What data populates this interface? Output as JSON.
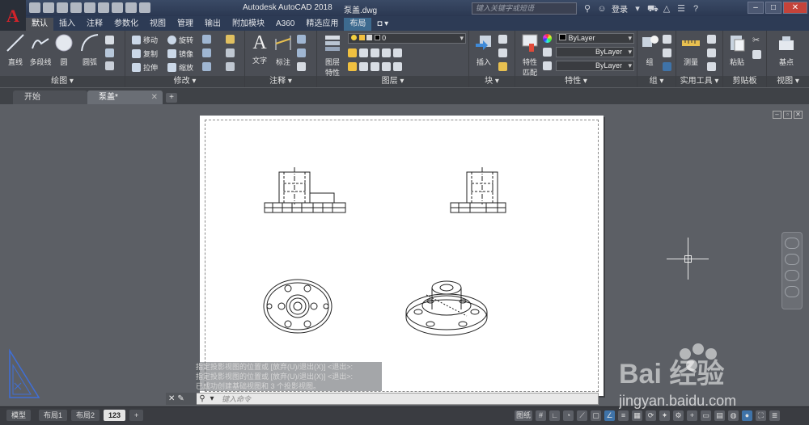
{
  "window": {
    "app_title": "Autodesk AutoCAD 2018",
    "file_title": "泵盖.dwg",
    "search_placeholder": "键入关键字或短语",
    "login_label": "登录",
    "app_letter": "A"
  },
  "ribbon_tabs": [
    "默认",
    "插入",
    "注释",
    "参数化",
    "视图",
    "管理",
    "输出",
    "附加模块",
    "A360",
    "精选应用",
    "布局",
    "◘ ▾"
  ],
  "ribbon": {
    "draw": {
      "title": "绘图 ▾",
      "line": "直线",
      "polyline": "多段线",
      "circle": "圆",
      "arc": "圆弧"
    },
    "modify": {
      "title": "修改 ▾",
      "move": "移动",
      "rotate": "旋转",
      "copy": "复制",
      "mirror": "镜像",
      "stretch": "拉伸",
      "scale": "缩放"
    },
    "annotation": {
      "title": "注释 ▾",
      "text": "文字",
      "dimension": "标注"
    },
    "layers": {
      "title": "图层 ▾",
      "properties_line1": "图层",
      "properties_line2": "特性",
      "current_layer": "0"
    },
    "block": {
      "title": "块 ▾",
      "insert": "插入"
    },
    "properties": {
      "title": "特性 ▾",
      "match_line1": "特性",
      "match_line2": "匹配",
      "color": "ByLayer",
      "linetype": "ByLayer",
      "lineweight": "ByLayer"
    },
    "groups": {
      "title": "组 ▾",
      "group": "组"
    },
    "utilities": {
      "title": "实用工具 ▾",
      "measure": "测量"
    },
    "clipboard": {
      "title": "剪贴板",
      "paste": "粘贴"
    },
    "view": {
      "title": "视图 ▾",
      "base": "基点"
    }
  },
  "doc_tabs": [
    {
      "label": "开始"
    },
    {
      "label": "泵盖*"
    }
  ],
  "command": {
    "history": [
      "指定投影视图的位置或 [放弃(U)/退出(X)] <退出>:",
      "指定投影视图的位置或 [放弃(U)/退出(X)] <退出>:",
      "已成功创建基础视图和 3 个投影视图。"
    ],
    "prompt": "键入命令"
  },
  "layout_tabs": [
    "模型",
    "布局1",
    "布局2",
    "123"
  ],
  "status": {
    "paper_label": "图纸"
  },
  "watermark": {
    "brand": "Bai 经验",
    "url": "jingyan.baidu.com"
  }
}
